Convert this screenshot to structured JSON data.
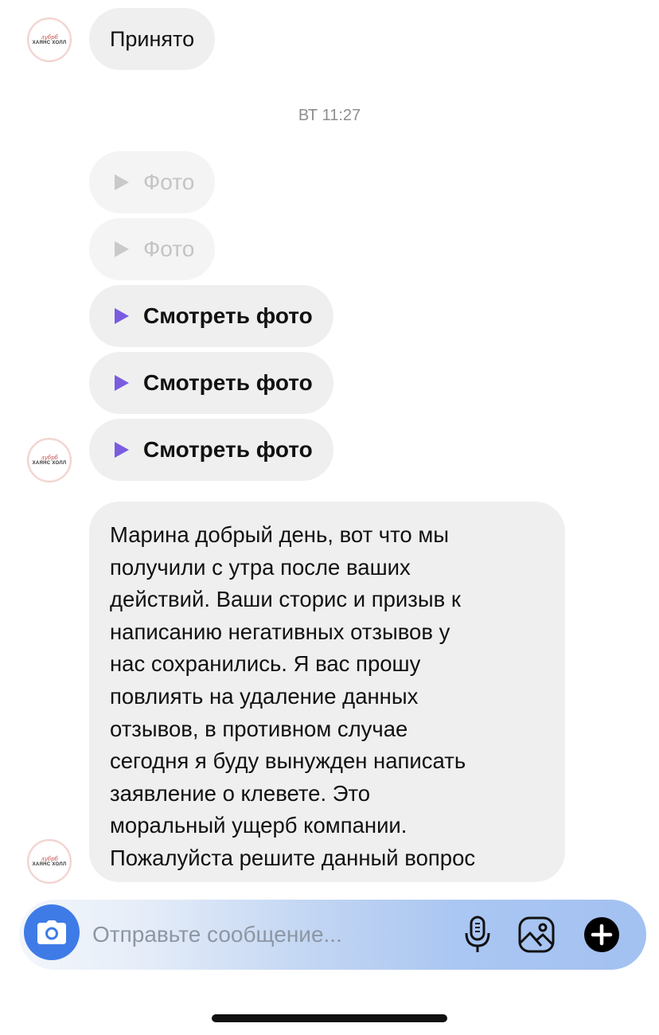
{
  "avatar": {
    "script_text": "лубрб",
    "mark_text": "ХАЯНС ХОЛЛ"
  },
  "messages": {
    "accepted": "Принято",
    "timestamp": "ВТ 11:27",
    "expired_photo_1": "Фото",
    "expired_photo_2": "Фото",
    "view_photo_1": "Смотреть фото",
    "view_photo_2": "Смотреть фото",
    "view_photo_3": "Смотреть фото",
    "long_lines": [
      "Марина добрый день, вот что мы",
      "получили с утра после ваших",
      "действий. Ваши сторис и призыв к",
      "написанию негативных отзывов у",
      "нас сохранились. Я вас прошу",
      "повлиять на удаление данных",
      "отзывов, в противном случае",
      "сегодня я буду вынужден написать",
      "заявление о клевете. Это",
      "моральный ущерб компании.",
      "Пожалуйста решите данный вопрос"
    ]
  },
  "composer": {
    "placeholder": "Отправьте сообщение...",
    "icons": [
      "camera-icon",
      "microphone-icon",
      "gallery-icon",
      "plus-icon"
    ]
  },
  "colors": {
    "bubble": "#efefef",
    "play_active": "#7a5ce0",
    "camera_button": "#3f7be6",
    "timestamp": "#8e8e8e"
  }
}
